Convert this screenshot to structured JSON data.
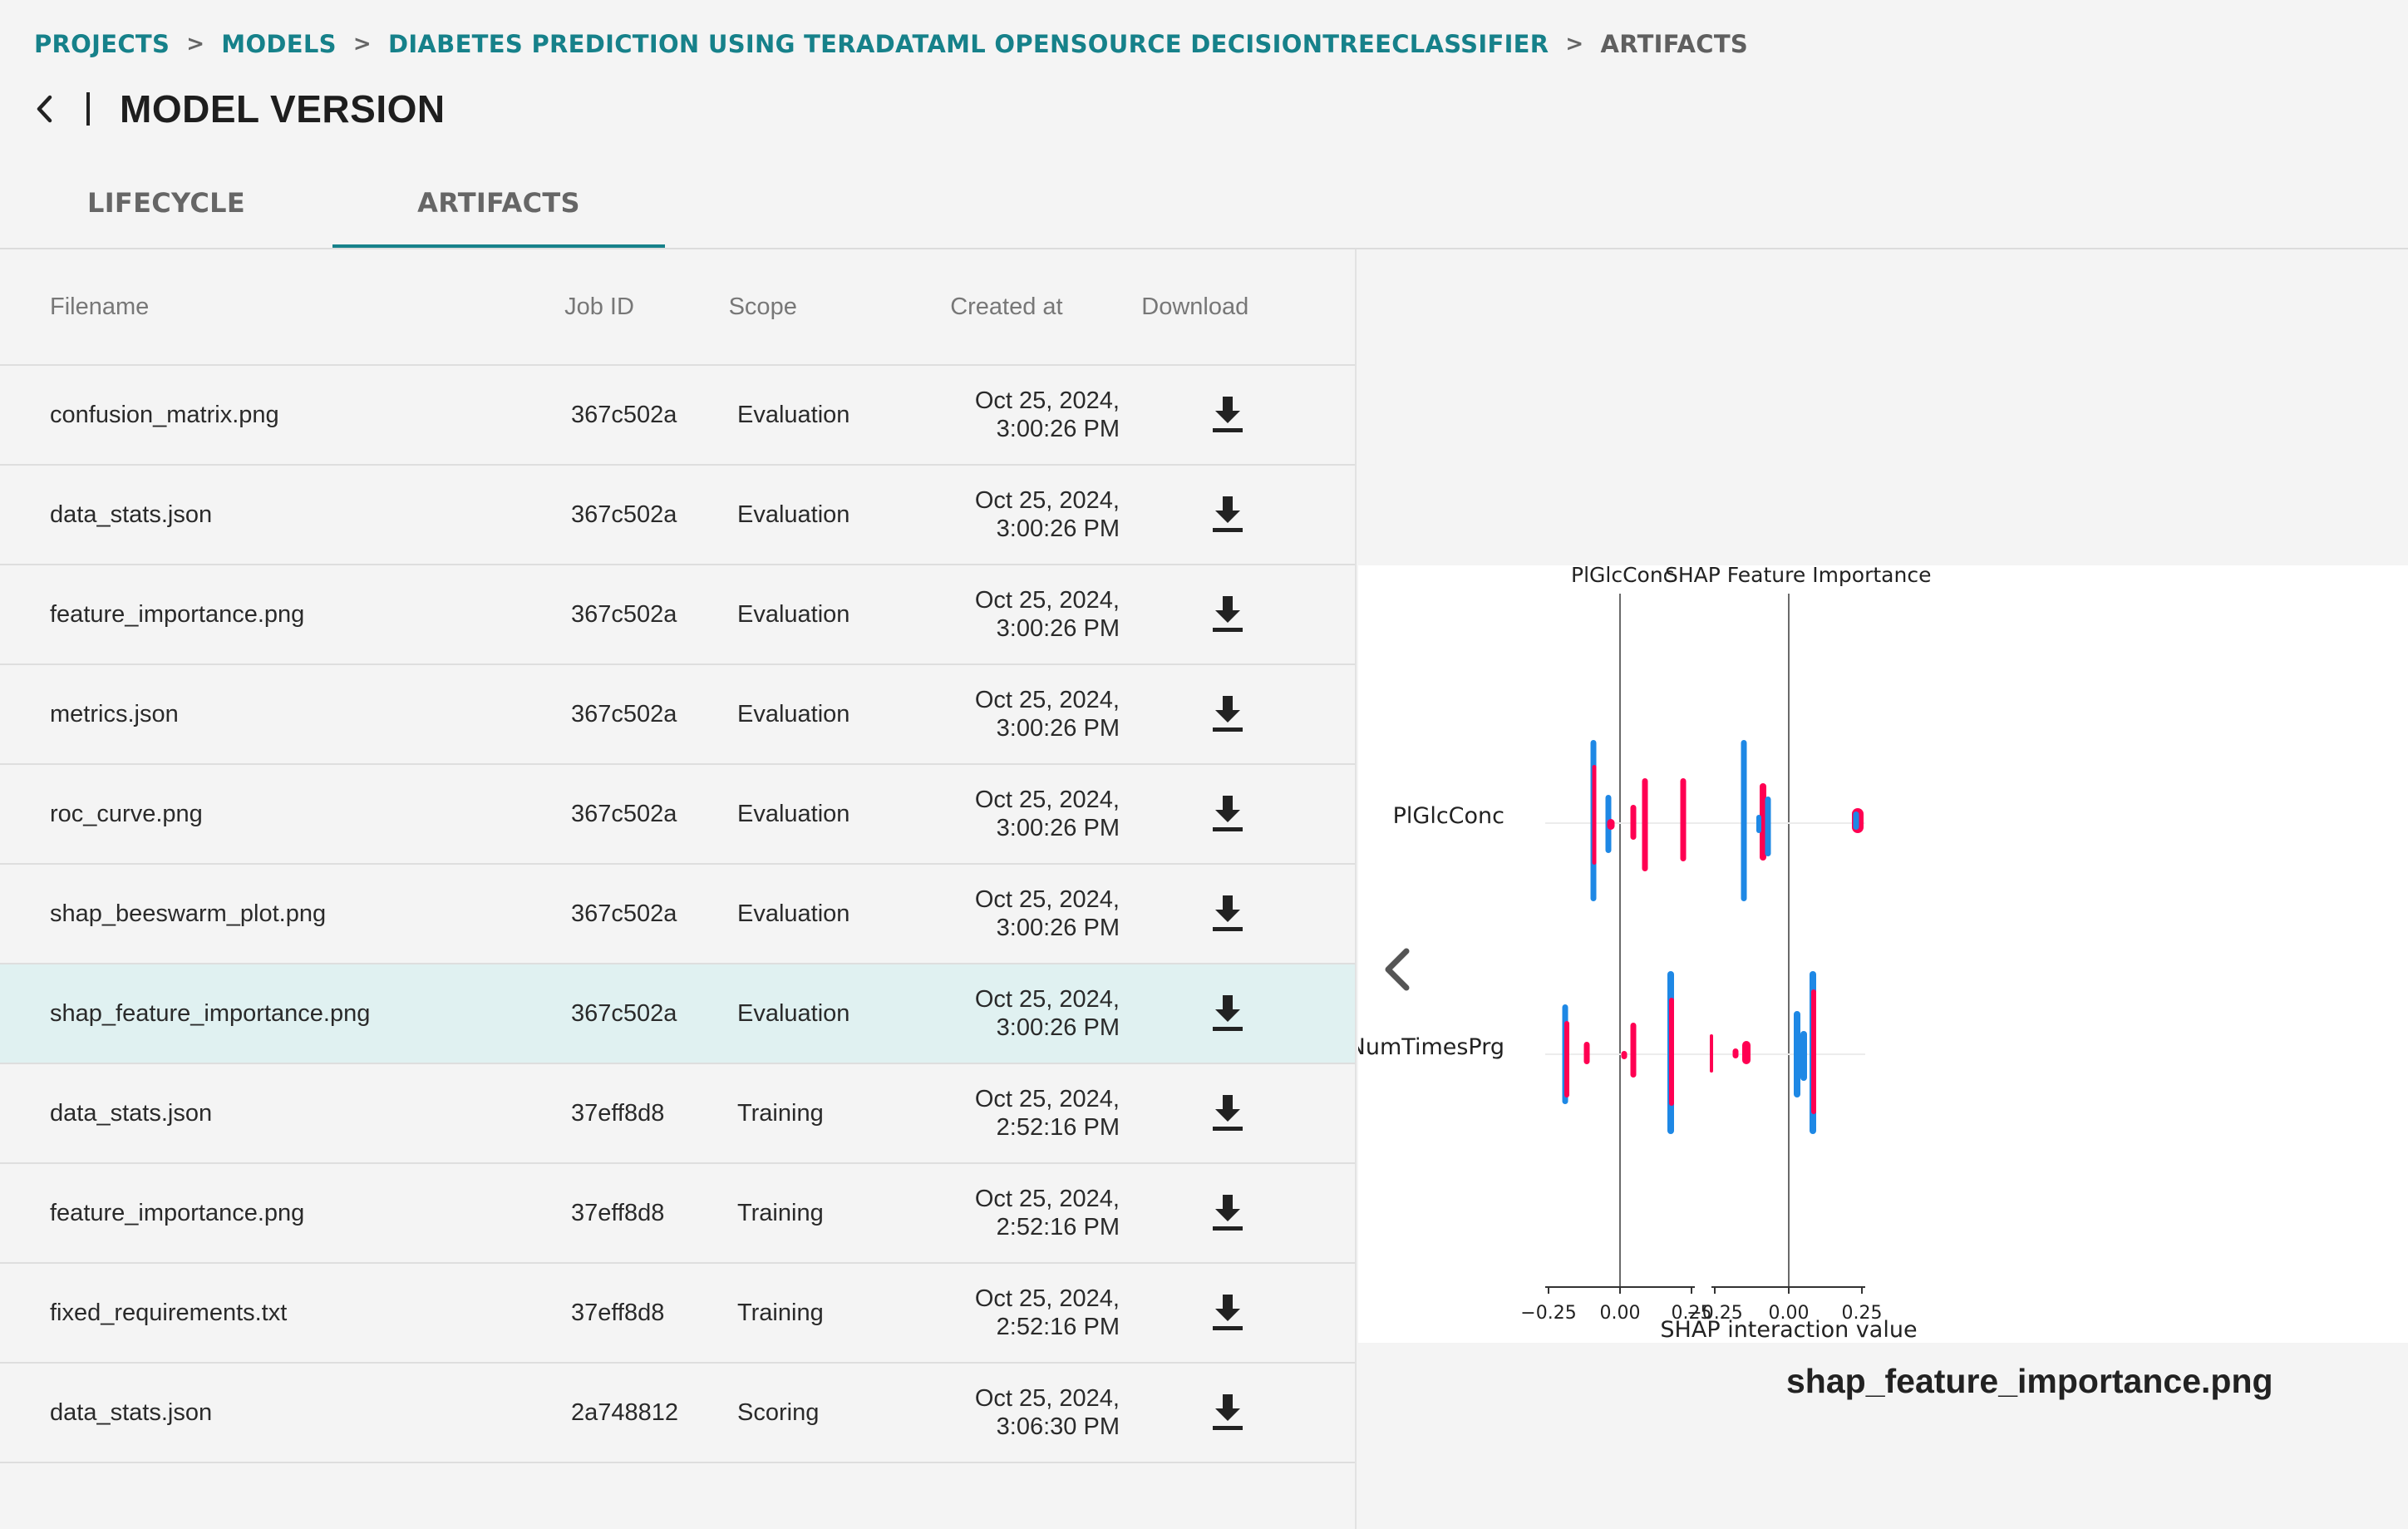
{
  "breadcrumb": {
    "projects": "PROJECTS",
    "models": "MODELS",
    "model": "DIABETES PREDICTION USING TERADATAML OPENSOURCE DECISIONTREECLASSIFIER",
    "current": "ARTIFACTS",
    "separator": ">"
  },
  "header": {
    "title": "MODEL VERSION"
  },
  "tabs": [
    {
      "label": "LIFECYCLE",
      "active": false
    },
    {
      "label": "ARTIFACTS",
      "active": true
    }
  ],
  "table": {
    "columns": [
      "Filename",
      "Job ID",
      "Scope",
      "Created at",
      "Download"
    ],
    "rows": [
      {
        "filename": "confusion_matrix.png",
        "job_id": "367c502a",
        "scope": "Evaluation",
        "date": "Oct 25, 2024,",
        "time": "3:00:26 PM"
      },
      {
        "filename": "data_stats.json",
        "job_id": "367c502a",
        "scope": "Evaluation",
        "date": "Oct 25, 2024,",
        "time": "3:00:26 PM"
      },
      {
        "filename": "feature_importance.png",
        "job_id": "367c502a",
        "scope": "Evaluation",
        "date": "Oct 25, 2024,",
        "time": "3:00:26 PM"
      },
      {
        "filename": "metrics.json",
        "job_id": "367c502a",
        "scope": "Evaluation",
        "date": "Oct 25, 2024,",
        "time": "3:00:26 PM"
      },
      {
        "filename": "roc_curve.png",
        "job_id": "367c502a",
        "scope": "Evaluation",
        "date": "Oct 25, 2024,",
        "time": "3:00:26 PM"
      },
      {
        "filename": "shap_beeswarm_plot.png",
        "job_id": "367c502a",
        "scope": "Evaluation",
        "date": "Oct 25, 2024,",
        "time": "3:00:26 PM"
      },
      {
        "filename": "shap_feature_importance.png",
        "job_id": "367c502a",
        "scope": "Evaluation",
        "date": "Oct 25, 2024,",
        "time": "3:00:26 PM",
        "selected": true
      },
      {
        "filename": "data_stats.json",
        "job_id": "37eff8d8",
        "scope": "Training",
        "date": "Oct 25, 2024,",
        "time": "2:52:16 PM"
      },
      {
        "filename": "feature_importance.png",
        "job_id": "37eff8d8",
        "scope": "Training",
        "date": "Oct 25, 2024,",
        "time": "2:52:16 PM"
      },
      {
        "filename": "fixed_requirements.txt",
        "job_id": "37eff8d8",
        "scope": "Training",
        "date": "Oct 25, 2024,",
        "time": "2:52:16 PM"
      },
      {
        "filename": "data_stats.json",
        "job_id": "2a748812",
        "scope": "Scoring",
        "date": "Oct 25, 2024,",
        "time": "3:06:30 PM"
      }
    ]
  },
  "preview": {
    "caption": "shap_feature_importance.png",
    "plot": {
      "title_left": "PlGlcConc",
      "title_right": "SHAP Feature Importance",
      "feature_labels": [
        "PlGlcConc",
        "NumTimesPrg"
      ],
      "xlabel": "SHAP interaction value",
      "ticks_left": [
        "−0.25",
        "0.00",
        "0.25"
      ],
      "ticks_right": [
        "−0.25",
        "0.00",
        "0.25"
      ],
      "colors": {
        "high": "#ff0052",
        "low": "#1e88e5"
      }
    }
  },
  "icons": {
    "back": "chevron-left-icon",
    "download": "download-icon",
    "prev": "chevron-left-icon"
  },
  "accent_color": "#16818a"
}
